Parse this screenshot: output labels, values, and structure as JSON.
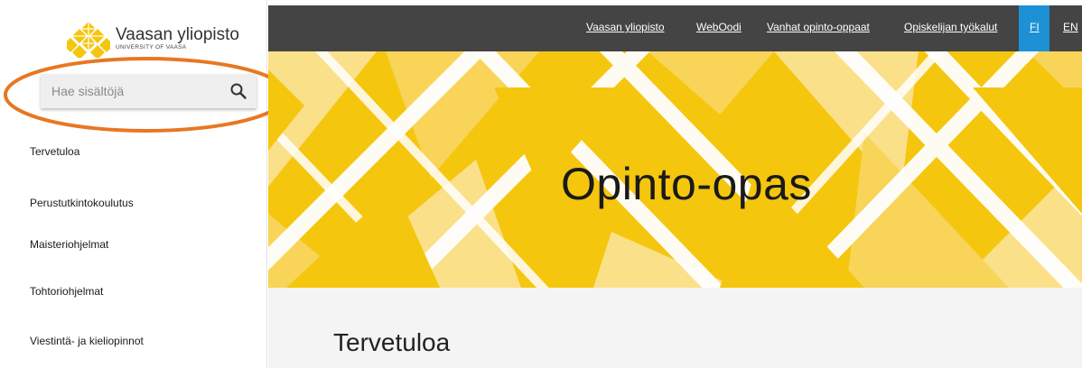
{
  "logo": {
    "name": "Vaasan yliopisto",
    "subtitle": "UNIVERSITY OF VAASA"
  },
  "search": {
    "placeholder": "Hae sisältöjä",
    "icon": "search-icon"
  },
  "sidebar": {
    "items": [
      {
        "label": "Tervetuloa"
      },
      {
        "label": "Perustutkintokoulutus"
      },
      {
        "label": "Maisteriohjelmat"
      },
      {
        "label": "Tohtoriohjelmat"
      },
      {
        "label": "Viestintä- ja kieliopinnot"
      }
    ]
  },
  "topbar": {
    "links": [
      {
        "label": "Vaasan yliopisto"
      },
      {
        "label": "WebOodi"
      },
      {
        "label": "Vanhat opinto-oppaat"
      },
      {
        "label": "Opiskelijan työkalut"
      }
    ],
    "languages": {
      "fi": "FI",
      "en": "EN"
    }
  },
  "hero": {
    "title": "Opinto-opas"
  },
  "content": {
    "heading": "Tervetuloa"
  },
  "colors": {
    "accent_yellow": "#f5c60e",
    "topbar": "#444444",
    "active_language": "#1e90d6",
    "annotation_ring": "#e87722"
  }
}
